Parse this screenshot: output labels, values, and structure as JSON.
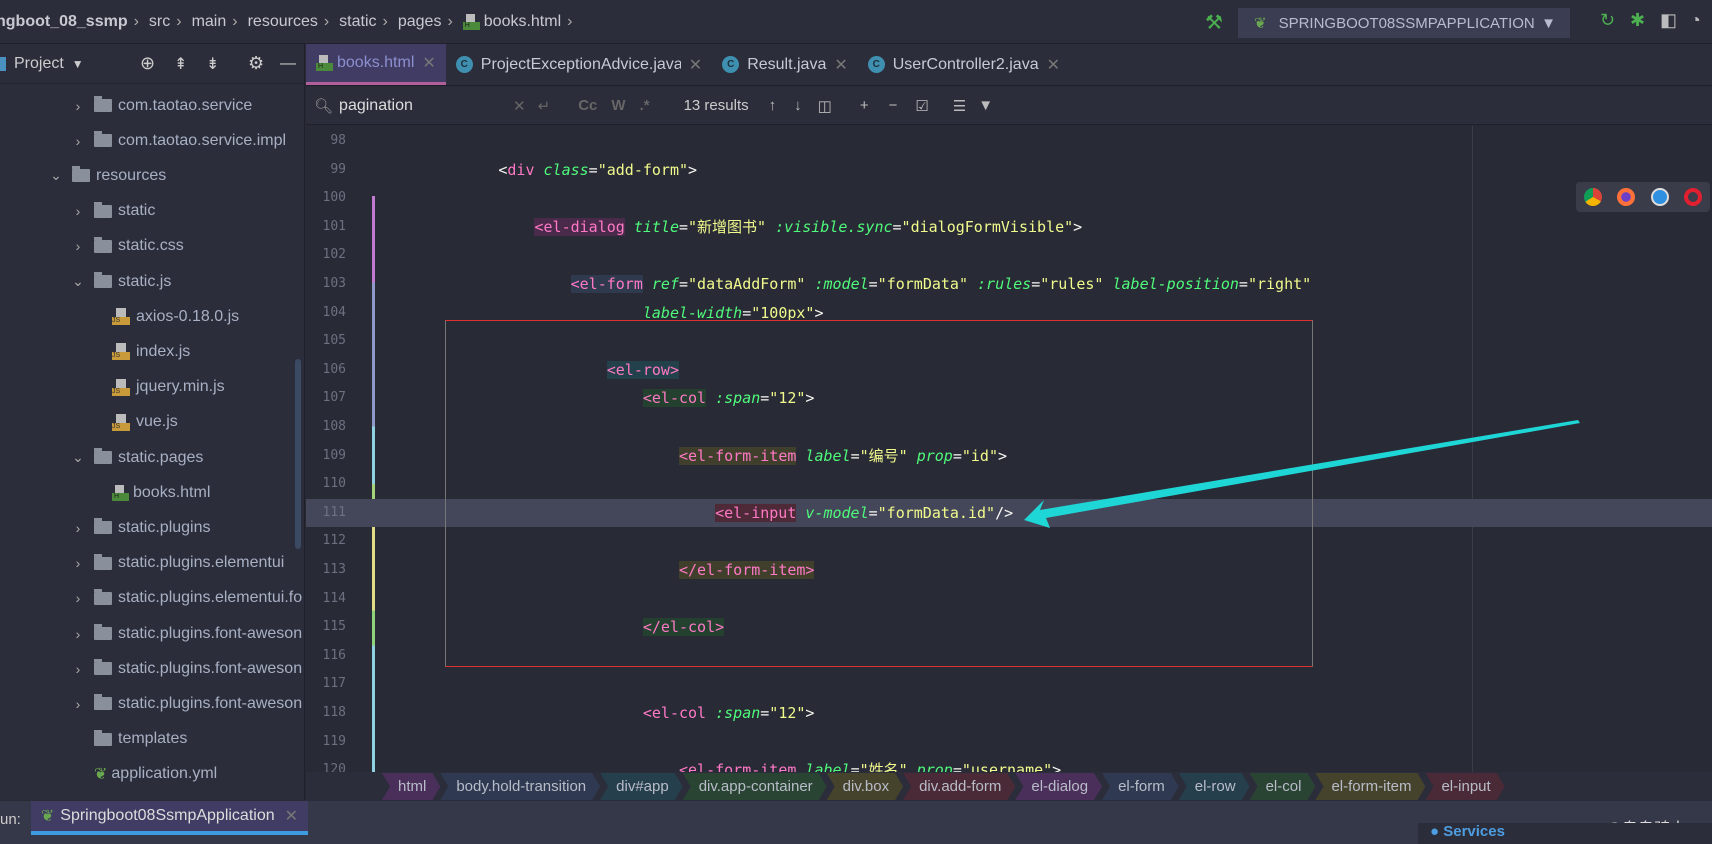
{
  "breadcrumb": [
    "ngboot_08_ssmp",
    "src",
    "main",
    "resources",
    "static",
    "pages",
    "books.html"
  ],
  "run_config": {
    "label": "SPRINGBOOT08SSMPAPPLICATION"
  },
  "sidebar": {
    "title": "Project",
    "items": [
      {
        "label": "com.taotao.service",
        "level": 2,
        "kind": "package",
        "expanded": false
      },
      {
        "label": "com.taotao.service.impl",
        "level": 2,
        "kind": "package",
        "expanded": false
      },
      {
        "label": "resources",
        "level": 1,
        "kind": "resources",
        "expanded": true
      },
      {
        "label": "static",
        "level": 2,
        "kind": "folder",
        "expanded": false
      },
      {
        "label": "static.css",
        "level": 2,
        "kind": "folder",
        "expanded": false
      },
      {
        "label": "static.js",
        "level": 2,
        "kind": "folder",
        "expanded": true
      },
      {
        "label": "axios-0.18.0.js",
        "level": 3,
        "kind": "js"
      },
      {
        "label": "index.js",
        "level": 3,
        "kind": "js"
      },
      {
        "label": "jquery.min.js",
        "level": 3,
        "kind": "js"
      },
      {
        "label": "vue.js",
        "level": 3,
        "kind": "js"
      },
      {
        "label": "static.pages",
        "level": 2,
        "kind": "folder",
        "expanded": true
      },
      {
        "label": "books.html",
        "level": 3,
        "kind": "html"
      },
      {
        "label": "static.plugins",
        "level": 2,
        "kind": "folder",
        "expanded": false
      },
      {
        "label": "static.plugins.elementui",
        "level": 2,
        "kind": "folder",
        "expanded": false
      },
      {
        "label": "static.plugins.elementui.fo",
        "level": 2,
        "kind": "folder",
        "expanded": false
      },
      {
        "label": "static.plugins.font-aweson",
        "level": 2,
        "kind": "folder",
        "expanded": false
      },
      {
        "label": "static.plugins.font-aweson",
        "level": 2,
        "kind": "folder",
        "expanded": false
      },
      {
        "label": "static.plugins.font-aweson",
        "level": 2,
        "kind": "folder",
        "expanded": false
      },
      {
        "label": "templates",
        "level": 2,
        "kind": "folder"
      },
      {
        "label": "application.yml",
        "level": 2,
        "kind": "spring"
      }
    ]
  },
  "tabs": [
    {
      "label": "books.html",
      "active": true,
      "icon": "html-file-icon"
    },
    {
      "label": "ProjectExceptionAdvice.java",
      "active": false,
      "icon": "class-icon"
    },
    {
      "label": "Result.java",
      "active": false,
      "icon": "class-icon"
    },
    {
      "label": "UserController2.java",
      "active": false,
      "icon": "class-icon"
    }
  ],
  "search": {
    "query": "pagination",
    "results": "13 results",
    "case_label": "Cc",
    "word_label": "W",
    "regex_label": ".*"
  },
  "editor": {
    "current_line": 111,
    "lines": [
      {
        "n": "98",
        "indent": 0,
        "tokens": []
      },
      {
        "n": "99",
        "indent": 12,
        "tokens": [
          {
            "t": "<",
            "c": "punct"
          },
          {
            "t": "div",
            "c": "tag"
          },
          {
            "t": " ",
            "c": "plain"
          },
          {
            "t": "class",
            "c": "attr"
          },
          {
            "t": "=",
            "c": "punct"
          },
          {
            "t": "\"add-form\"",
            "c": "str"
          },
          {
            "t": ">",
            "c": "punct"
          }
        ]
      },
      {
        "n": "100",
        "indent": 0,
        "tokens": []
      },
      {
        "n": "101",
        "indent": 16,
        "tokens": [
          {
            "t": "<el-dialog",
            "c": "tag",
            "bg": "dialog"
          },
          {
            "t": " ",
            "c": "plain"
          },
          {
            "t": "title",
            "c": "attr"
          },
          {
            "t": "=",
            "c": "punct"
          },
          {
            "t": "\"新增图书\"",
            "c": "str"
          },
          {
            "t": " ",
            "c": "plain"
          },
          {
            "t": ":visible.sync",
            "c": "attr"
          },
          {
            "t": "=",
            "c": "punct"
          },
          {
            "t": "\"dialogFormVisible\"",
            "c": "str"
          },
          {
            "t": ">",
            "c": "punct"
          }
        ]
      },
      {
        "n": "102",
        "indent": 0,
        "tokens": []
      },
      {
        "n": "103",
        "indent": 20,
        "tokens": [
          {
            "t": "<el-form",
            "c": "tag",
            "bg": "form"
          },
          {
            "t": " ",
            "c": "plain"
          },
          {
            "t": "ref",
            "c": "attr"
          },
          {
            "t": "=",
            "c": "punct"
          },
          {
            "t": "\"dataAddForm\"",
            "c": "str"
          },
          {
            "t": " ",
            "c": "plain"
          },
          {
            "t": ":model",
            "c": "attr"
          },
          {
            "t": "=",
            "c": "punct"
          },
          {
            "t": "\"formData\"",
            "c": "str"
          },
          {
            "t": " ",
            "c": "plain"
          },
          {
            "t": ":rules",
            "c": "attr"
          },
          {
            "t": "=",
            "c": "punct"
          },
          {
            "t": "\"rules\"",
            "c": "str"
          },
          {
            "t": " ",
            "c": "plain"
          },
          {
            "t": "label-position",
            "c": "attr"
          },
          {
            "t": "=",
            "c": "punct"
          },
          {
            "t": "\"right\"",
            "c": "str"
          }
        ]
      },
      {
        "n": "104",
        "indent": 28,
        "tokens": [
          {
            "t": "label-width",
            "c": "attr"
          },
          {
            "t": "=",
            "c": "punct"
          },
          {
            "t": "\"100px\"",
            "c": "str"
          },
          {
            "t": ">",
            "c": "punct"
          }
        ]
      },
      {
        "n": "105",
        "indent": 0,
        "tokens": []
      },
      {
        "n": "106",
        "indent": 24,
        "tokens": [
          {
            "t": "<el-row>",
            "c": "tag",
            "bg": "row"
          }
        ]
      },
      {
        "n": "107",
        "indent": 28,
        "tokens": [
          {
            "t": "<el-col",
            "c": "tag",
            "bg": "col"
          },
          {
            "t": " ",
            "c": "plain"
          },
          {
            "t": ":span",
            "c": "attr"
          },
          {
            "t": "=",
            "c": "punct"
          },
          {
            "t": "\"12\"",
            "c": "str"
          },
          {
            "t": ">",
            "c": "punct"
          }
        ]
      },
      {
        "n": "108",
        "indent": 0,
        "tokens": []
      },
      {
        "n": "109",
        "indent": 32,
        "tokens": [
          {
            "t": "<el-form-item",
            "c": "tag",
            "bg": "item"
          },
          {
            "t": " ",
            "c": "plain"
          },
          {
            "t": "label",
            "c": "attr"
          },
          {
            "t": "=",
            "c": "punct"
          },
          {
            "t": "\"编号\"",
            "c": "str"
          },
          {
            "t": " ",
            "c": "plain"
          },
          {
            "t": "prop",
            "c": "attr"
          },
          {
            "t": "=",
            "c": "punct"
          },
          {
            "t": "\"id\"",
            "c": "str"
          },
          {
            "t": ">",
            "c": "punct"
          }
        ]
      },
      {
        "n": "110",
        "indent": 0,
        "tokens": []
      },
      {
        "n": "111",
        "indent": 36,
        "tokens": [
          {
            "t": "<el-input",
            "c": "tag",
            "bg": "input"
          },
          {
            "t": " ",
            "c": "plain"
          },
          {
            "t": "v-model",
            "c": "attr"
          },
          {
            "t": "=",
            "c": "punct"
          },
          {
            "t": "\"formData.id\"",
            "c": "str"
          },
          {
            "t": "/>",
            "c": "punct"
          }
        ]
      },
      {
        "n": "112",
        "indent": 0,
        "tokens": []
      },
      {
        "n": "113",
        "indent": 32,
        "tokens": [
          {
            "t": "</el-form-item>",
            "c": "tag",
            "bg": "item"
          }
        ]
      },
      {
        "n": "114",
        "indent": 0,
        "tokens": []
      },
      {
        "n": "115",
        "indent": 28,
        "tokens": [
          {
            "t": "</el-col>",
            "c": "tag",
            "bg": "col"
          }
        ]
      },
      {
        "n": "116",
        "indent": 0,
        "tokens": []
      },
      {
        "n": "117",
        "indent": 0,
        "tokens": []
      },
      {
        "n": "118",
        "indent": 28,
        "tokens": [
          {
            "t": "<el-col",
            "c": "tag"
          },
          {
            "t": " ",
            "c": "plain"
          },
          {
            "t": ":span",
            "c": "attr"
          },
          {
            "t": "=",
            "c": "punct"
          },
          {
            "t": "\"12\"",
            "c": "str"
          },
          {
            "t": ">",
            "c": "punct"
          }
        ]
      },
      {
        "n": "119",
        "indent": 0,
        "tokens": []
      },
      {
        "n": "120",
        "indent": 32,
        "tokens": [
          {
            "t": "<el-form-item",
            "c": "tag"
          },
          {
            "t": " ",
            "c": "plain"
          },
          {
            "t": "label",
            "c": "attr"
          },
          {
            "t": "=",
            "c": "punct"
          },
          {
            "t": "\"姓名\"",
            "c": "str"
          },
          {
            "t": " ",
            "c": "plain"
          },
          {
            "t": "prop",
            "c": "attr"
          },
          {
            "t": "=",
            "c": "punct"
          },
          {
            "t": "\"username\"",
            "c": "str"
          },
          {
            "t": ">",
            "c": "punct"
          }
        ]
      }
    ]
  },
  "tag_path": [
    {
      "label": "html",
      "color": "#4a2f5a"
    },
    {
      "label": "body.hold-transition",
      "color": "#2f3a52"
    },
    {
      "label": "div#app",
      "color": "#263f4c"
    },
    {
      "label": "div.app-container",
      "color": "#2a4434"
    },
    {
      "label": "div.box",
      "color": "#45432c"
    },
    {
      "label": "div.add-form",
      "color": "#4a2a36"
    },
    {
      "label": "el-dialog",
      "color": "#4a2f5a"
    },
    {
      "label": "el-form",
      "color": "#2f3a52"
    },
    {
      "label": "el-row",
      "color": "#263f4c"
    },
    {
      "label": "el-col",
      "color": "#2a4434"
    },
    {
      "label": "el-form-item",
      "color": "#45432c"
    },
    {
      "label": "el-input",
      "color": "#4a2a36"
    }
  ],
  "run": {
    "prefix": "un:",
    "tab": "Springboot08SsmpApplication"
  },
  "services_label": "Services",
  "watermark": "CSDN @鬼鬼骑士",
  "annotation_colors": {
    "box": "#e03030",
    "arrow": "#1fd6d6"
  }
}
